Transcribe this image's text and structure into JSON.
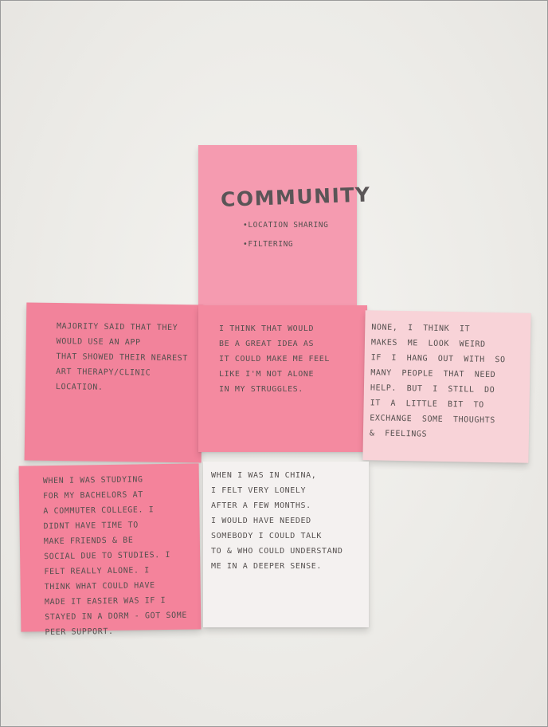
{
  "title_note": {
    "title": "COMMUNITY",
    "bullets": [
      "LOCATION SHARING",
      "FILTERING"
    ]
  },
  "notes": [
    {
      "color": "#f2839b",
      "lines": [
        "MAJORITY SAID THAT THEY",
        "WOULD USE AN APP",
        "THAT SHOWED THEIR NEAREST",
        "ART THERAPY/CLINIC LOCATION."
      ]
    },
    {
      "color": "#f48aa0",
      "lines": [
        "I THINK THAT WOULD",
        "BE A GREAT IDEA AS",
        "IT COULD MAKE ME FEEL",
        "LIKE I'M NOT ALONE",
        "IN MY STRUGGLES."
      ]
    },
    {
      "color": "#f8d3d8",
      "lines": [
        "NONE, I THINK IT",
        "MAKES ME LOOK WEIRD",
        "IF I HANG OUT WITH SO",
        "MANY PEOPLE THAT NEED",
        "HELP. BUT I STILL DO",
        "IT A LITTLE BIT TO",
        "EXCHANGE SOME THOUGHTS",
        "& FEELINGS"
      ]
    },
    {
      "color": "#f4839b",
      "lines": [
        "WHEN I WAS STUDYING",
        "FOR MY BACHELORS AT",
        "A COMMUTER COLLEGE. I",
        "DIDNT HAVE TIME TO",
        "MAKE FRIENDS & BE",
        "SOCIAL DUE TO STUDIES. I",
        "FELT REALLY ALONE. I",
        "THINK WHAT COULD HAVE",
        "MADE IT EASIER WAS IF I",
        "STAYED IN A DORM - GOT SOME",
        "PEER SUPPORT."
      ]
    },
    {
      "color": "#f4f1f0",
      "lines": [
        "WHEN I WAS IN CHINA,",
        "I FELT VERY LONELY",
        "AFTER A FEW MONTHS.",
        "I WOULD HAVE NEEDED",
        "SOMEBODY I COULD TALK",
        "TO & WHO COULD UNDERSTAND",
        "ME IN A DEEPER SENSE."
      ]
    }
  ],
  "colors": {
    "title_note": "#f59bb0",
    "wall": "#efedea",
    "ink": "#55504f"
  }
}
